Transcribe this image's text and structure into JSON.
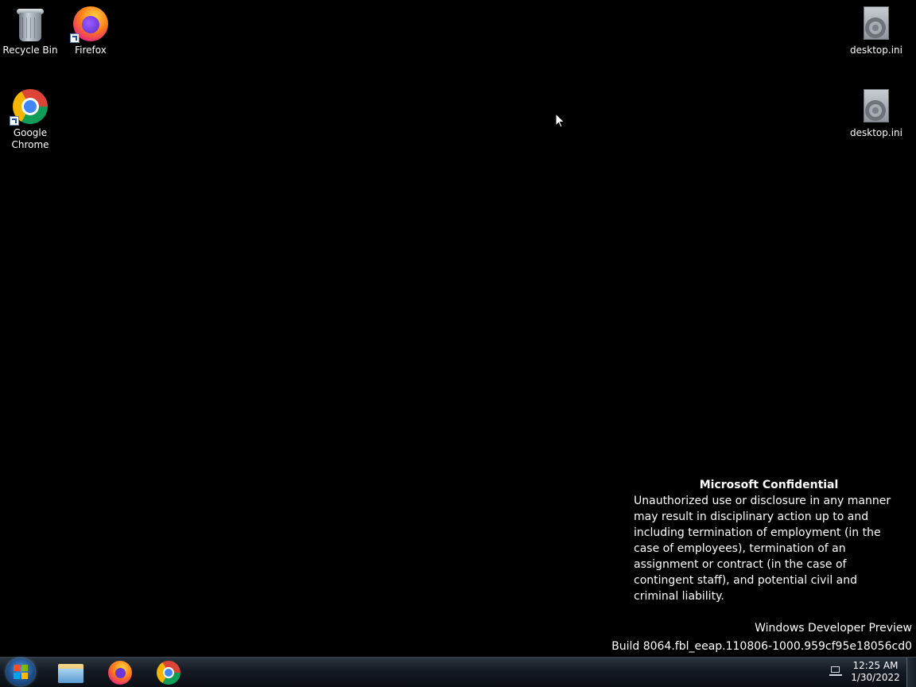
{
  "desktop": {
    "icons": [
      {
        "label": "Recycle Bin",
        "icon": "recycle-bin-icon"
      },
      {
        "label": "Firefox",
        "icon": "firefox-icon",
        "shortcut": true
      },
      {
        "label": "Google Chrome",
        "icon": "chrome-icon",
        "shortcut": true
      },
      {
        "label": "desktop.ini",
        "icon": "settings-file-icon"
      },
      {
        "label": "desktop.ini",
        "icon": "settings-file-icon"
      }
    ]
  },
  "notice": {
    "title": "Microsoft Confidential",
    "body": "Unauthorized use or disclosure in any manner may result in disciplinary action up to and including termination of employment (in the case of employees), termination of an assignment or contract (in the case of contingent staff), and potential civil and criminal liability."
  },
  "watermark": {
    "edition": "Windows Developer Preview",
    "build": "Build 8064.fbl_eeap.110806-1000.959cf95e18056cd0"
  },
  "taskbar": {
    "start_icon": "windows-logo-icon",
    "pinned": [
      {
        "name": "File Explorer",
        "icon": "folder-icon"
      },
      {
        "name": "Firefox",
        "icon": "firefox-icon"
      },
      {
        "name": "Google Chrome",
        "icon": "chrome-icon"
      }
    ],
    "tray_icon": "network-icon",
    "clock": {
      "time": "12:25 AM",
      "date": "1/30/2022"
    }
  },
  "colors": {
    "background": "#000000",
    "text": "#ffffff",
    "taskbar": "#141a22"
  }
}
